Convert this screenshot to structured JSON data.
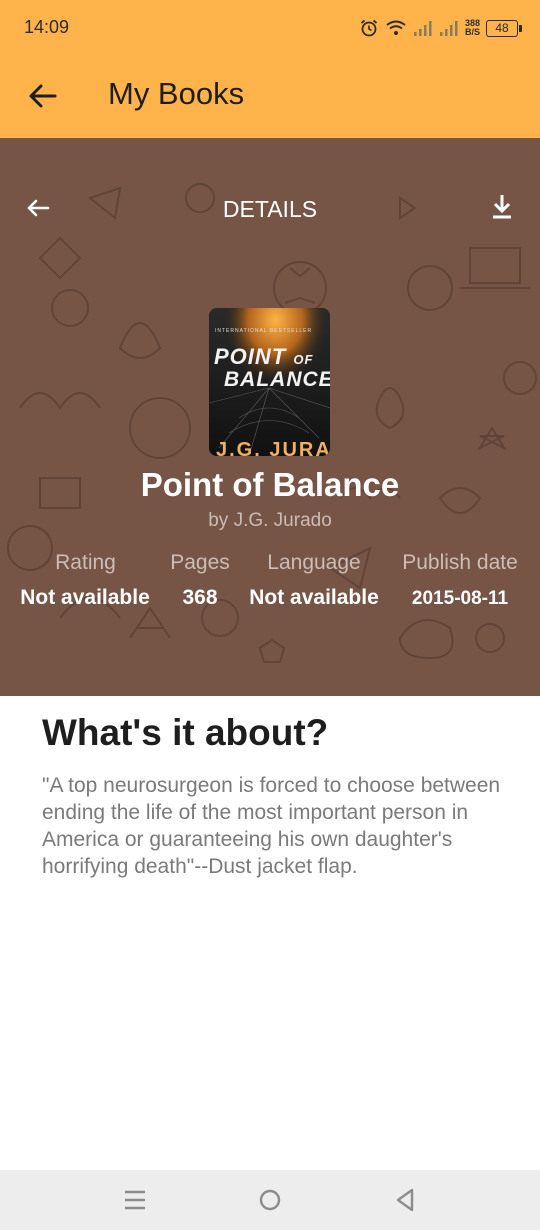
{
  "status_bar": {
    "time": "14:09",
    "net_speed_value": "388",
    "net_speed_unit": "B/S",
    "battery": "48",
    "icons": [
      "alarm-icon",
      "wifi-icon",
      "signal-icon",
      "signal-icon"
    ]
  },
  "app_bar": {
    "back_icon": "arrow-left-icon",
    "title": "My Books"
  },
  "hero": {
    "back_icon": "arrow-left-icon",
    "header": "DETAILS",
    "download_icon": "download-icon",
    "cover": {
      "tagline": "INTERNATIONAL BESTSELLER",
      "title_line1": "POINT",
      "title_of": "OF",
      "title_line2": "BALANCE",
      "author": "J.G. JURADO"
    },
    "title": "Point of Balance",
    "author": "by J.G. Jurado",
    "stats": [
      {
        "label": "Rating",
        "value": "Not available"
      },
      {
        "label": "Pages",
        "value": "368"
      },
      {
        "label": "Language",
        "value": "Not available"
      },
      {
        "label": "Publish date",
        "value": "2015-08-11"
      }
    ]
  },
  "about": {
    "heading": "What's it about?",
    "text": "\"A top neurosurgeon is forced to choose between ending the life of the most important person in America or guaranteeing his own daughter's horrifying death\"--Dust jacket flap."
  },
  "nav_bar": {
    "icons": [
      "menu-icon",
      "home-circle-icon",
      "back-triangle-icon"
    ]
  },
  "colors": {
    "accent": "#ffb34a",
    "hero_bg": "#765446"
  }
}
